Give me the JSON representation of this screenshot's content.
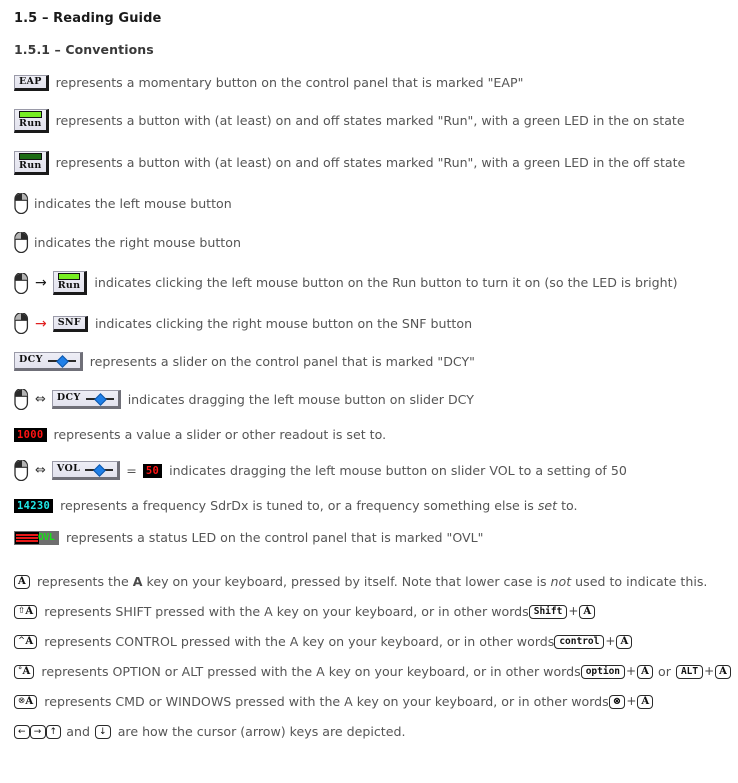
{
  "document": {
    "heading1": "1.5 – Reading Guide",
    "heading2": "1.5.1 – Conventions"
  },
  "colors": {
    "led_on": "#77ee22",
    "led_off": "#1b6b14",
    "readout_red": "#ff1414",
    "readout_cyan": "#22e8e8",
    "slider_knob": "#1f7fe8",
    "red_arrow": "#e02020",
    "ovl_text": "#19e019",
    "ovl_bars": "#e81818"
  },
  "rows": [
    {
      "id": "eap-button",
      "widget_label": "EAP",
      "text": "represents a momentary button on the control panel that is marked \"EAP\""
    },
    {
      "id": "run-button-on",
      "widget_label": "Run",
      "led_state": "on",
      "text": "represents a button with (at least) on and off states marked \"Run\", with a green LED in the on state"
    },
    {
      "id": "run-button-off",
      "widget_label": "Run",
      "led_state": "off",
      "text": "represents a button with (at least) on and off states marked \"Run\", with a green LED in the off state"
    },
    {
      "id": "left-mouse",
      "text": "indicates the left mouse button"
    },
    {
      "id": "right-mouse",
      "text": "indicates the right mouse button"
    },
    {
      "id": "left-click-run",
      "arrow": "→",
      "widget_label": "Run",
      "led_state": "on",
      "text": "indicates clicking the left mouse button on the Run button to turn it on (so the LED is bright)"
    },
    {
      "id": "right-click-snf",
      "arrow": "→",
      "widget_label": "SNF",
      "text": "indicates clicking the right mouse button on the SNF button"
    },
    {
      "id": "dcy-slider",
      "widget_label": "DCY",
      "text": "represents a slider on the control panel that is marked \"DCY\""
    },
    {
      "id": "drag-dcy-slider",
      "arrow": "⇔",
      "widget_label": "DCY",
      "text": "indicates dragging the left mouse button on slider DCY"
    },
    {
      "id": "readout-1000",
      "value": "1000",
      "text": "represents a value a slider or other readout is set to."
    },
    {
      "id": "drag-vol-slider",
      "arrow": "⇔",
      "widget_label": "VOL",
      "equals": "=",
      "value": "50",
      "text": "indicates dragging the left mouse button on slider VOL to a setting of 50"
    },
    {
      "id": "frequency-readout",
      "value": "14230",
      "text_before": "represents a frequency SdrDx is tuned to, or a frequency something else is ",
      "text_italic": "set",
      "text_after": " to."
    },
    {
      "id": "ovl-status-led",
      "widget_label": "OVL",
      "text": "represents a status LED on the control panel that is marked \"OVL\""
    }
  ],
  "keyboard_rows": [
    {
      "id": "key-a",
      "key": "A",
      "text_before": "represents the ",
      "text_bold": "A",
      "text_mid": " key on your keyboard, pressed by itself. Note that lower case is ",
      "text_italic": "not",
      "text_after": " used to indicate this."
    },
    {
      "id": "key-shift-a",
      "modifier": "⇧",
      "key": "A",
      "text_before": "represents SHIFT pressed with the A key on your keyboard, or in other words ",
      "combo": [
        {
          "type": "word",
          "label": "Shift"
        },
        {
          "type": "plus",
          "label": "+"
        },
        {
          "type": "key",
          "label": "A"
        }
      ]
    },
    {
      "id": "key-control-a",
      "modifier": "^",
      "key": "A",
      "text_before": "represents CONTROL pressed with the A key on your keyboard, or in other words ",
      "combo": [
        {
          "type": "word",
          "label": "control"
        },
        {
          "type": "plus",
          "label": "+"
        },
        {
          "type": "key",
          "label": "A"
        }
      ]
    },
    {
      "id": "key-option-a",
      "modifier": "°",
      "key": "A",
      "text_before": "represents OPTION or ALT pressed with the A key on your keyboard, or in other words ",
      "combo": [
        {
          "type": "word",
          "label": "option"
        },
        {
          "type": "plus",
          "label": "+"
        },
        {
          "type": "key",
          "label": "A"
        },
        {
          "type": "or",
          "label": "or"
        },
        {
          "type": "word",
          "label": "ALT"
        },
        {
          "type": "plus",
          "label": "+"
        },
        {
          "type": "key",
          "label": "A"
        }
      ]
    },
    {
      "id": "key-cmd-a",
      "modifier": "⊗",
      "key": "A",
      "text_before": "represents CMD or WINDOWS pressed with the A key on your keyboard, or in other words ",
      "combo": [
        {
          "type": "key",
          "label": "⊗"
        },
        {
          "type": "plus",
          "label": "+"
        },
        {
          "type": "key",
          "label": "A"
        }
      ]
    }
  ],
  "cursor_row": {
    "id": "cursor-keys",
    "keys_left": [
      "←",
      "→",
      "↑"
    ],
    "text_mid": "and",
    "key_right": "↓",
    "text_after": "are how the cursor (arrow) keys are depicted."
  }
}
